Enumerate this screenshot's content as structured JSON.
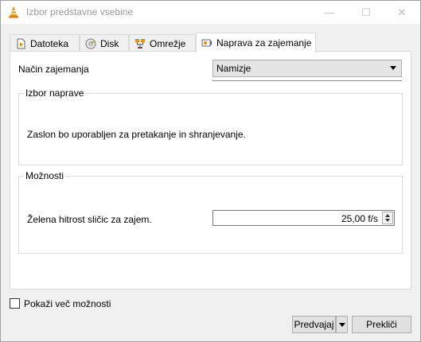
{
  "window": {
    "title": "Izbor predstavne vsebine",
    "minimize_glyph": "—",
    "maximize_glyph": "☐",
    "close_glyph": "✕"
  },
  "tabs": [
    {
      "label": "Datoteka",
      "icon": "file-icon"
    },
    {
      "label": "Disk",
      "icon": "disc-icon"
    },
    {
      "label": "Omrežje",
      "icon": "network-icon"
    },
    {
      "label": "Naprava za zajemanje",
      "icon": "capture-device-icon",
      "active": true
    }
  ],
  "capture": {
    "mode_label": "Način zajemanja",
    "mode_value": "Namizje"
  },
  "device_group": {
    "title": "Izbor naprave",
    "text": "Zaslon bo uporabljen za pretakanje in shranjevanje."
  },
  "options_group": {
    "title": "Možnosti",
    "fps_label": "Želena hitrost sličic za zajem.",
    "fps_value": "25,00 f/s"
  },
  "footer": {
    "more_options_label": "Pokaži več možnosti",
    "more_options_checked": false,
    "play_label": "Predvajaj",
    "cancel_label": "Prekliči"
  },
  "colors": {
    "vlc_orange": "#f08a00",
    "background": "#f0f0f0"
  }
}
